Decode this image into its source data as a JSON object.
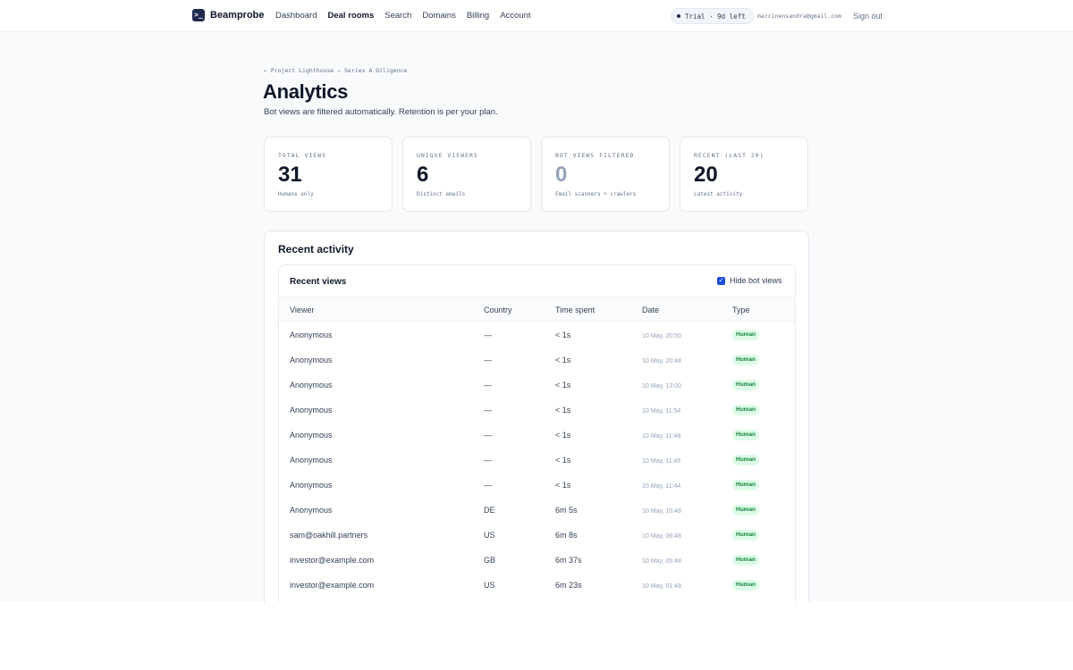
{
  "app": {
    "name": "Beamprobe",
    "logo_glyph": ">_"
  },
  "nav": {
    "links": [
      "Dashboard",
      "Deal rooms",
      "Search",
      "Domains",
      "Billing",
      "Account"
    ],
    "active": "Deal rooms"
  },
  "trial": {
    "label": "Trial · 9d left"
  },
  "user": {
    "email": "marcinensandra@gmail.com",
    "signout": "Sign out"
  },
  "header": {
    "breadcrumb": "← Project Lighthouse — Series A Diligence",
    "title": "Analytics",
    "subtitle": "Bot views are filtered automatically. Retention is per your plan."
  },
  "stats": [
    {
      "label": "TOTAL VIEWS",
      "value": "31",
      "note": "Humans only"
    },
    {
      "label": "UNIQUE VIEWERS",
      "value": "6",
      "note": "Distinct emails"
    },
    {
      "label": "BOT VIEWS FILTERED",
      "value": "0",
      "note": "Email scanners + crawlers"
    },
    {
      "label": "RECENT (LAST 20)",
      "value": "20",
      "note": "Latest activity"
    }
  ],
  "activity": {
    "title": "Recent activity",
    "panel_title": "Recent views",
    "hide_bots": {
      "label": "Hide bot views",
      "checked": true
    },
    "columns": [
      "Viewer",
      "Country",
      "Time spent",
      "Date",
      "Type"
    ],
    "rows": [
      {
        "viewer": "Anonymous",
        "country": "—",
        "time": "< 1s",
        "date": "10 May, 20:50",
        "type": "Human"
      },
      {
        "viewer": "Anonymous",
        "country": "—",
        "time": "< 1s",
        "date": "10 May, 20:48",
        "type": "Human"
      },
      {
        "viewer": "Anonymous",
        "country": "—",
        "time": "< 1s",
        "date": "10 May, 13:00",
        "type": "Human"
      },
      {
        "viewer": "Anonymous",
        "country": "—",
        "time": "< 1s",
        "date": "10 May, 11:54",
        "type": "Human"
      },
      {
        "viewer": "Anonymous",
        "country": "—",
        "time": "< 1s",
        "date": "10 May, 11:48",
        "type": "Human"
      },
      {
        "viewer": "Anonymous",
        "country": "—",
        "time": "< 1s",
        "date": "10 May, 11:45",
        "type": "Human"
      },
      {
        "viewer": "Anonymous",
        "country": "—",
        "time": "< 1s",
        "date": "10 May, 11:44",
        "type": "Human"
      },
      {
        "viewer": "Anonymous",
        "country": "DE",
        "time": "6m 5s",
        "date": "10 May, 10:48",
        "type": "Human"
      },
      {
        "viewer": "sam@oakhill.partners",
        "country": "US",
        "time": "6m 8s",
        "date": "10 May, 06:48",
        "type": "Human"
      },
      {
        "viewer": "investor@example.com",
        "country": "GB",
        "time": "6m 37s",
        "date": "10 May, 05:48",
        "type": "Human"
      },
      {
        "viewer": "investor@example.com",
        "country": "US",
        "time": "6m 23s",
        "date": "10 May, 01:48",
        "type": "Human"
      }
    ]
  },
  "colors": {
    "brand": "#1e2a4a",
    "accent": "#1d4ed8",
    "badge_bg": "#dcfce7",
    "badge_text": "#15803d"
  }
}
